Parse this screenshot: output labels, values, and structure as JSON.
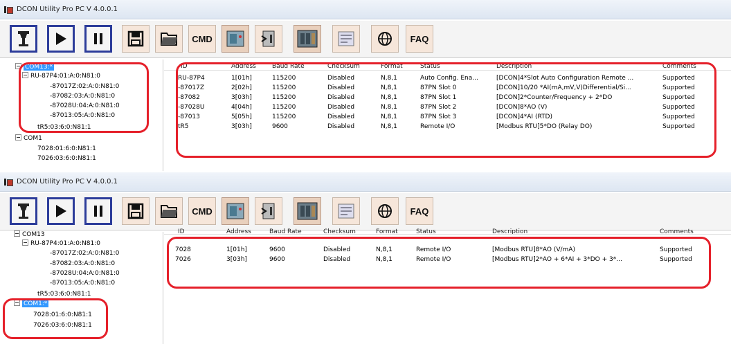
{
  "app": {
    "title": "DCON Utility Pro PC V 4.0.0.1"
  },
  "toolbar": {
    "cmd_label": "CMD",
    "faq_label": "FAQ"
  },
  "columns": {
    "id": "ID",
    "address": "Address",
    "baud": "Baud Rate",
    "checksum": "Checksum",
    "format": "Format",
    "status": "Status",
    "description": "Description",
    "comments": "Comments"
  },
  "window1": {
    "tree": [
      {
        "label": "COM13:*",
        "selected": true
      },
      {
        "label": "RU-87P4:01:A:0:N81:0"
      },
      {
        "label": "-87017Z:02:A:0:N81:0"
      },
      {
        "label": "-87082:03:A:0:N81:0"
      },
      {
        "label": "-87028U:04:A:0:N81:0"
      },
      {
        "label": "-87013:05:A:0:N81:0"
      },
      {
        "label": "tR5:03:6:0:N81:1"
      },
      {
        "label": "COM1"
      },
      {
        "label": "7028:01:6:0:N81:1"
      },
      {
        "label": "7026:03:6:0:N81:1"
      }
    ],
    "rows": [
      {
        "id": "RU-87P4",
        "address": "1[01h]",
        "baud": "115200",
        "checksum": "Disabled",
        "format": "N,8,1",
        "status": "Auto Config. Ena...",
        "description": "[DCON]4*Slot Auto Configuration Remote ...",
        "comments": "Supported"
      },
      {
        "id": "-87017Z",
        "address": "2[02h]",
        "baud": "115200",
        "checksum": "Disabled",
        "format": "N,8,1",
        "status": "87PN Slot 0",
        "description": "[DCON]10/20 *AI(mA,mV,V)Differential/Si...",
        "comments": "Supported"
      },
      {
        "id": "-87082",
        "address": "3[03h]",
        "baud": "115200",
        "checksum": "Disabled",
        "format": "N,8,1",
        "status": "87PN Slot 1",
        "description": "[DCON]2*Counter/Frequency + 2*DO",
        "comments": "Supported"
      },
      {
        "id": "-87028U",
        "address": "4[04h]",
        "baud": "115200",
        "checksum": "Disabled",
        "format": "N,8,1",
        "status": "87PN Slot 2",
        "description": "[DCON]8*AO (V)",
        "comments": "Supported"
      },
      {
        "id": "-87013",
        "address": "5[05h]",
        "baud": "115200",
        "checksum": "Disabled",
        "format": "N,8,1",
        "status": "87PN Slot 3",
        "description": "[DCON]4*AI (RTD)",
        "comments": "Supported"
      },
      {
        "id": "tR5",
        "address": "3[03h]",
        "baud": "9600",
        "checksum": "Disabled",
        "format": "N,8,1",
        "status": "Remote I/O",
        "description": "[Modbus RTU]5*DO (Relay DO)",
        "comments": "Supported"
      }
    ]
  },
  "window2": {
    "tree": [
      {
        "label": "COM13"
      },
      {
        "label": "RU-87P4:01:A:0:N81:0"
      },
      {
        "label": "-87017Z:02:A:0:N81:0"
      },
      {
        "label": "-87082:03:A:0:N81:0"
      },
      {
        "label": "-87028U:04:A:0:N81:0"
      },
      {
        "label": "-87013:05:A:0:N81:0"
      },
      {
        "label": "tR5:03:6:0:N81:1"
      },
      {
        "label": "COM1:*",
        "selected": true
      },
      {
        "label": "7028:01:6:0:N81:1"
      },
      {
        "label": "7026:03:6:0:N81:1"
      }
    ],
    "rows": [
      {
        "id": "7028",
        "address": "1[01h]",
        "baud": "9600",
        "checksum": "Disabled",
        "format": "N,8,1",
        "status": "Remote I/O",
        "description": "[Modbus RTU]8*AO (V/mA)",
        "comments": "Supported"
      },
      {
        "id": "7026",
        "address": "3[03h]",
        "baud": "9600",
        "checksum": "Disabled",
        "format": "N,8,1",
        "status": "Remote I/O",
        "description": "[Modbus RTU]2*AO + 6*AI + 3*DO + 3*...",
        "comments": "Supported"
      }
    ]
  },
  "icons": [
    "search-device-icon",
    "play-icon",
    "pause-icon",
    "save-icon",
    "open-folder-icon",
    "cmd-icon",
    "module-icon",
    "firmware-icon",
    "device-icon",
    "terminal-icon",
    "globe-icon",
    "faq-icon"
  ],
  "colors": {
    "highlight": "#e5202a",
    "selection": "#3399ff",
    "toolbar_button": "#f0d9c8",
    "accent_border": "#2c3c9a"
  }
}
